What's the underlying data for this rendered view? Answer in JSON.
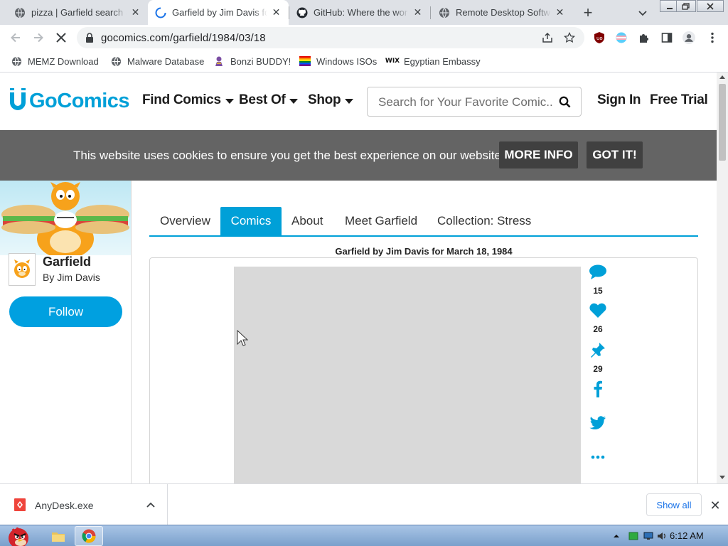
{
  "browser": {
    "tabs": [
      {
        "title": "pizza | Garfield search a",
        "icon": "globe-icon",
        "active": false
      },
      {
        "title": "Garfield by Jim Davis fo",
        "icon": "loading-spinner-icon",
        "active": true
      },
      {
        "title": "GitHub: Where the wor",
        "icon": "github-icon",
        "active": false
      },
      {
        "title": "Remote Desktop Softw",
        "icon": "globe-icon",
        "active": false
      }
    ],
    "url": "gocomics.com/garfield/1984/03/18",
    "bookmarks": [
      {
        "label": "MEMZ Download",
        "icon": "globe-icon"
      },
      {
        "label": "Malware Database",
        "icon": "globe-icon"
      },
      {
        "label": "Bonzi BUDDY!",
        "icon": "bonzi-icon"
      },
      {
        "label": "Windows ISOs",
        "icon": "rainbow-flag-icon"
      },
      {
        "label": "Egyptian Embassy",
        "icon": "wix-icon"
      }
    ]
  },
  "site": {
    "logo": "GoComics",
    "nav": {
      "find_comics": "Find Comics",
      "best_of": "Best Of",
      "shop": "Shop",
      "sign_in": "Sign In",
      "free_trial": "Free Trial"
    },
    "search_placeholder": "Search for Your Favorite Comic..."
  },
  "cookie_banner": {
    "text": "This website uses cookies to ensure you get the best experience on our website.",
    "more_info": "MORE INFO",
    "got_it": "GOT IT!"
  },
  "sidebar": {
    "strip_name": "Garfield",
    "author": "By Jim Davis",
    "follow": "Follow"
  },
  "page_tabs": [
    {
      "label": "Overview",
      "active": false
    },
    {
      "label": "Comics",
      "active": true
    },
    {
      "label": "About",
      "active": false
    },
    {
      "label": "Meet Garfield",
      "active": false
    },
    {
      "label": "Collection: Stress",
      "active": false
    }
  ],
  "comic": {
    "title": "Garfield by Jim Davis for March 18, 1984",
    "comments": "15",
    "likes": "26",
    "pins": "29"
  },
  "download": {
    "filename": "AnyDesk.exe",
    "show_all": "Show all"
  },
  "taskbar": {
    "clock": "6:12 AM"
  },
  "colors": {
    "brand": "#00a0d8",
    "cookie_bg": "#646464",
    "cookie_btn": "#404040",
    "tab_strip": "#dee1e6"
  }
}
